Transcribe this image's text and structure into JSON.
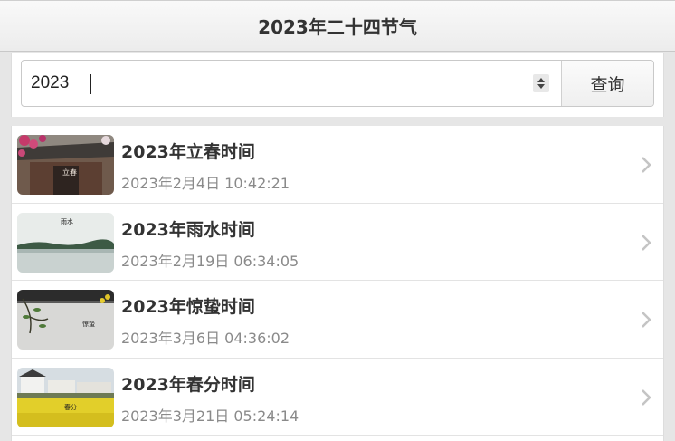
{
  "header": {
    "title": "2023年二十四节气"
  },
  "search": {
    "value": "2023",
    "button_label": "查询"
  },
  "items": [
    {
      "title": "2023年立春时间",
      "time": "2023年2月4日 10:42:21",
      "image": "lichun-thumbnail",
      "stamp": "立春"
    },
    {
      "title": "2023年雨水时间",
      "time": "2023年2月19日 06:34:05",
      "image": "yushui-thumbnail",
      "stamp": "雨水"
    },
    {
      "title": "2023年惊蛰时间",
      "time": "2023年3月6日 04:36:02",
      "image": "jingzhe-thumbnail",
      "stamp": "惊蛰"
    },
    {
      "title": "2023年春分时间",
      "time": "2023年3月21日 05:24:14",
      "image": "chunfen-thumbnail",
      "stamp": "春分"
    }
  ],
  "colors": {
    "title": "#333333",
    "subtitle": "#8a8a8a",
    "chevron": "#c4c4c4"
  },
  "icons": {
    "spinner": "number-spinner-icon",
    "chevron": "chevron-right-icon"
  }
}
